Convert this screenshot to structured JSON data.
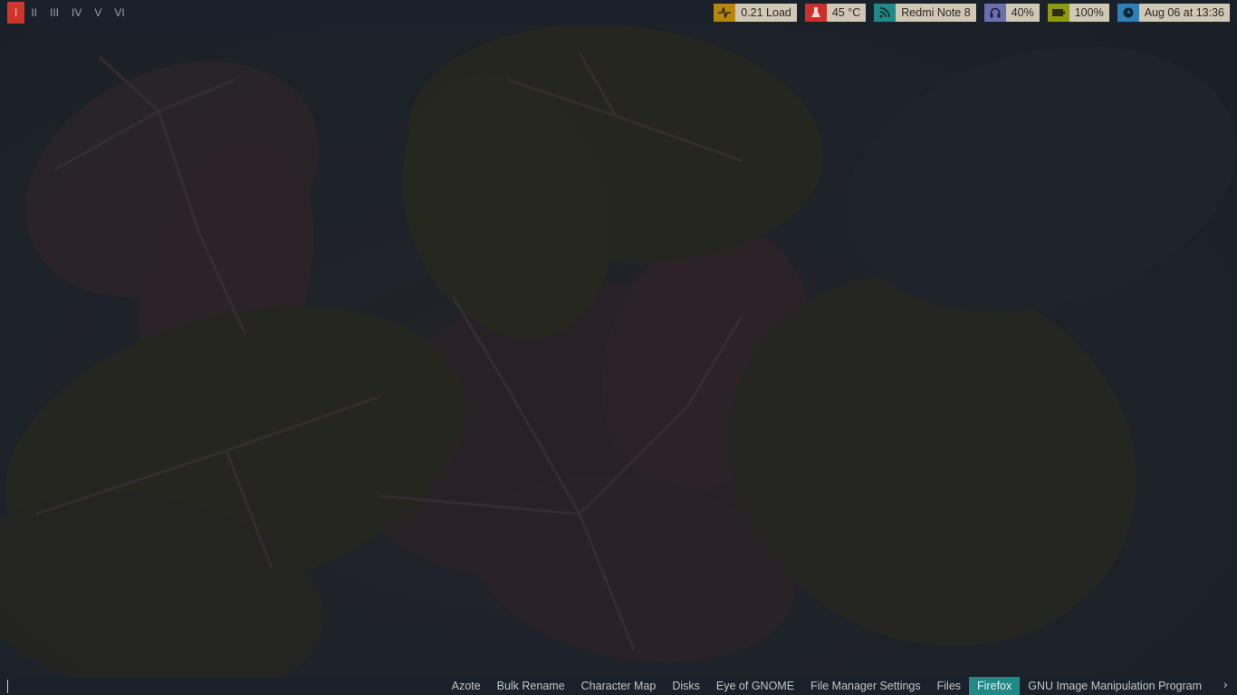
{
  "workspaces": [
    {
      "label": "I",
      "active": true
    },
    {
      "label": "II",
      "active": false
    },
    {
      "label": "III",
      "active": false
    },
    {
      "label": "IV",
      "active": false
    },
    {
      "label": "V",
      "active": false
    },
    {
      "label": "VI",
      "active": false
    }
  ],
  "status": {
    "load": {
      "icon": "pulse-icon",
      "color": "#b8860b",
      "text": "0.21 Load"
    },
    "temp": {
      "icon": "thermometer-icon",
      "color": "#cc2f2a",
      "text": "45 °C"
    },
    "network": {
      "icon": "wifi-icon",
      "color": "#1f8a86",
      "text": "Redmi Note 8"
    },
    "volume": {
      "icon": "headphones-icon",
      "color": "#6a6fb0",
      "text": "40%"
    },
    "battery": {
      "icon": "battery-icon",
      "color": "#8f9a0f",
      "text": "100%"
    },
    "clock": {
      "icon": "clock-icon",
      "color": "#2f80b8",
      "text": "Aug 06 at 13:36"
    }
  },
  "taskbar": {
    "tasks": [
      {
        "label": "Azote",
        "active": false
      },
      {
        "label": "Bulk Rename",
        "active": false
      },
      {
        "label": "Character Map",
        "active": false
      },
      {
        "label": "Disks",
        "active": false
      },
      {
        "label": "Eye of GNOME",
        "active": false
      },
      {
        "label": "File Manager Settings",
        "active": false
      },
      {
        "label": "Files",
        "active": false
      },
      {
        "label": "Firefox",
        "active": true
      },
      {
        "label": "GNU Image Manipulation Program",
        "active": false
      }
    ],
    "more_glyph": "›"
  }
}
